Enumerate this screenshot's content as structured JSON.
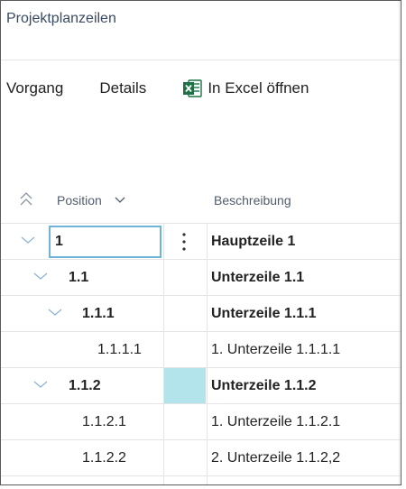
{
  "page": {
    "title": "Projektplanzeilen"
  },
  "actions": [
    {
      "label": "Vorgang",
      "icon": null
    },
    {
      "label": "Details",
      "icon": null
    },
    {
      "label": "In Excel öffnen",
      "icon": "excel-icon"
    }
  ],
  "columns": {
    "position": "Position",
    "description": "Beschreibung"
  },
  "rows": [
    {
      "position": "1",
      "description": "Hauptzeile 1",
      "bold": true,
      "expandable": true,
      "level": 0,
      "selected": true
    },
    {
      "position": "1.1",
      "description": "Unterzeile 1.1",
      "bold": true,
      "expandable": true,
      "level": 1
    },
    {
      "position": "1.1.1",
      "description": "Unterzeile 1.1.1",
      "bold": true,
      "expandable": true,
      "level": 2
    },
    {
      "position": "1.1.1.1",
      "description": "1. Unterzeile 1.1.1.1",
      "bold": false,
      "expandable": false,
      "level": 3
    },
    {
      "position": "1.1.2",
      "description": "Unterzeile 1.1.2",
      "bold": true,
      "expandable": true,
      "level": 1,
      "highlight": true
    },
    {
      "position": "1.1.2.1",
      "description": "1. Unterzeile 1.1.2.1",
      "bold": false,
      "expandable": false,
      "level": 2
    },
    {
      "position": "1.1.2.2",
      "description": "2. Unterzeile 1.1.2,2",
      "bold": false,
      "expandable": false,
      "level": 2
    }
  ],
  "colors": {
    "accent": "#6fb3d8",
    "highlight": "#b3e4ec",
    "excel_green": "#1d7245",
    "chevron": "#8fb7d6"
  }
}
